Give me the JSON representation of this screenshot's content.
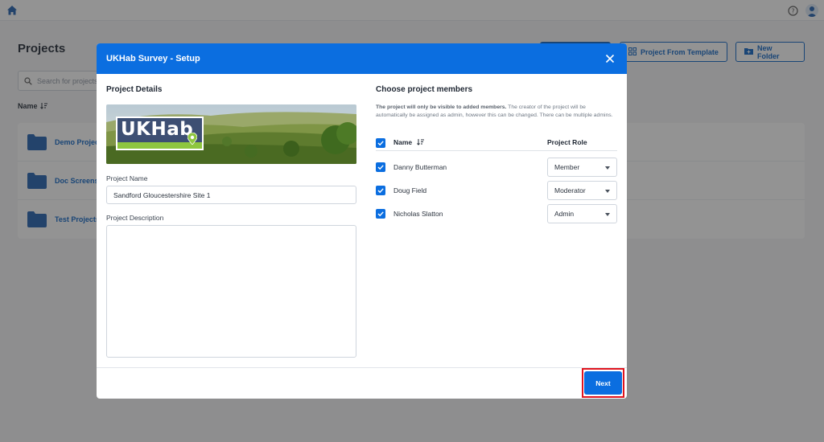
{
  "app": {
    "page_title": "Projects",
    "buttons": {
      "project_from_template": "Project From Template",
      "new_folder": "New Folder"
    },
    "search": {
      "placeholder": "Search for projects"
    },
    "sort_header": "Name",
    "folders": [
      {
        "name": "Demo Projects"
      },
      {
        "name": "Doc Screenshots"
      },
      {
        "name": "Test Projects"
      }
    ]
  },
  "modal": {
    "title": "UKHab Survey - Setup",
    "left": {
      "section_title": "Project Details",
      "banner_logo_text": "UKHab",
      "project_name_label": "Project Name",
      "project_name_value": "Sandford Gloucestershire Site 1",
      "project_description_label": "Project Description",
      "project_description_value": ""
    },
    "right": {
      "section_title": "Choose project members",
      "note_bold": "The project will only be visible to added members.",
      "note_rest": " The creator of the project will be automatically be assigned as admin, however this can be changed. There can be multiple admins.",
      "col_name": "Name",
      "col_role": "Project Role",
      "members": [
        {
          "name": "Danny Butterman",
          "role": "Member",
          "checked": true
        },
        {
          "name": "Doug Field",
          "role": "Moderator",
          "checked": true
        },
        {
          "name": "Nicholas Slatton",
          "role": "Admin",
          "checked": true
        }
      ]
    },
    "footer": {
      "next_label": "Next"
    }
  },
  "colors": {
    "primary": "#0b6ee0",
    "highlight": "#e0141e"
  }
}
